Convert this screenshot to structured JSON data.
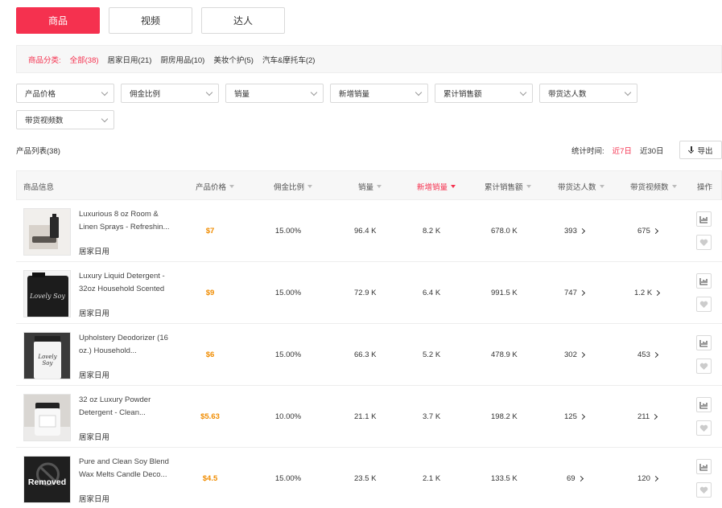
{
  "tabs": [
    {
      "label": "商品",
      "active": true
    },
    {
      "label": "视频",
      "active": false
    },
    {
      "label": "达人",
      "active": false
    }
  ],
  "categories": {
    "label": "商品分类:",
    "items": [
      {
        "label": "全部(38)",
        "active": true
      },
      {
        "label": "居家日用(21)",
        "active": false
      },
      {
        "label": "厨房用品(10)",
        "active": false
      },
      {
        "label": "美妆个护(5)",
        "active": false
      },
      {
        "label": "汽车&摩托车(2)",
        "active": false
      }
    ]
  },
  "filters": [
    "产品价格",
    "佣金比例",
    "销量",
    "新增销量",
    "累计销售额",
    "带货达人数",
    "带货视频数"
  ],
  "list": {
    "title": "产品列表(38)",
    "time_label": "统计时间:",
    "time_options": [
      {
        "label": "近7日",
        "active": true
      },
      {
        "label": "近30日",
        "active": false
      }
    ],
    "export_label": "导出"
  },
  "table": {
    "headers": {
      "info": "商品信息",
      "price": "产品价格",
      "commission": "佣金比例",
      "sales": "销量",
      "new_sales": "新增销量",
      "total_revenue": "累计销售额",
      "creators": "带货达人数",
      "videos": "带货视频数",
      "actions": "操作"
    },
    "sorted_column": "new_sales",
    "rows": [
      {
        "name": "Luxurious 8 oz Room & Linen Sprays - Refreshin...",
        "category": "居家日用",
        "price": "$7",
        "commission": "15.00%",
        "sales": "96.4 K",
        "new_sales": "8.2 K",
        "total_revenue": "678.0 K",
        "creators": "393",
        "videos": "675",
        "thumb": "spray-bottle"
      },
      {
        "name": "Luxury Liquid Detergent - 32oz Household Scented",
        "category": "居家日用",
        "price": "$9",
        "commission": "15.00%",
        "sales": "72.9 K",
        "new_sales": "6.4 K",
        "total_revenue": "991.5 K",
        "creators": "747",
        "videos": "1.2 K",
        "thumb": "detergent-jug"
      },
      {
        "name": "Upholstery Deodorizer (16 oz.) Household...",
        "category": "居家日用",
        "price": "$6",
        "commission": "15.00%",
        "sales": "66.3 K",
        "new_sales": "5.2 K",
        "total_revenue": "478.9 K",
        "creators": "302",
        "videos": "453",
        "thumb": "deodorizer-jar"
      },
      {
        "name": "32 oz Luxury Powder Detergent - Clean...",
        "category": "居家日用",
        "price": "$5.63",
        "commission": "10.00%",
        "sales": "21.1 K",
        "new_sales": "3.7 K",
        "total_revenue": "198.2 K",
        "creators": "125",
        "videos": "211",
        "thumb": "powder-jar"
      },
      {
        "name": "Pure and Clean Soy Blend Wax Melts Candle Deco...",
        "category": "居家日用",
        "price": "$4.5",
        "commission": "15.00%",
        "sales": "23.5 K",
        "new_sales": "2.1 K",
        "total_revenue": "133.5 K",
        "creators": "69",
        "videos": "120",
        "thumb": "removed",
        "thumb_text": "Removed"
      }
    ]
  },
  "colors": {
    "accent": "#f5314f",
    "price": "#f08c00",
    "border": "#d9d9d9",
    "header_bg": "#f7f7f7"
  }
}
